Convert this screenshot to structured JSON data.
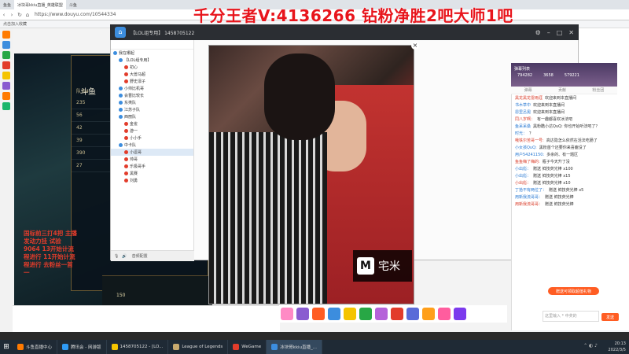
{
  "browser": {
    "tabs": [
      {
        "label": "鱼鱼",
        "active": false
      },
      {
        "label": "冰块哥kkiu直播_英雄联盟",
        "active": true
      },
      {
        "label": "斗鱼",
        "active": false
      }
    ],
    "url": "https://www.douyu.com/10544334",
    "bookmark": "点击加入收藏"
  },
  "banner": "千分王者V:4136266   钻粉净胜2吧大师1吧",
  "yy": {
    "title": "【LOL组专用】 1458705122",
    "tree": [
      {
        "label": "我在哪起",
        "indent": 0
      },
      {
        "label": "【LOL组专用】",
        "indent": 1
      },
      {
        "label": "初心",
        "indent": 2
      },
      {
        "label": "大兽马超",
        "indent": 2
      },
      {
        "label": "野史凛子",
        "indent": 2
      },
      {
        "label": "小帅比机哥",
        "indent": 1
      },
      {
        "label": "会晋比较长",
        "indent": 1
      },
      {
        "label": "东夷队",
        "indent": 1
      },
      {
        "label": "江苏子队",
        "indent": 1
      },
      {
        "label": "西丽队",
        "indent": 1
      },
      {
        "label": "金雀",
        "indent": 2
      },
      {
        "label": "游一",
        "indent": 2
      },
      {
        "label": "小小手",
        "indent": 2
      },
      {
        "label": "中卡队",
        "indent": 1
      },
      {
        "label": "小逗哥",
        "indent": 2,
        "selected": true
      },
      {
        "label": "帅哥",
        "indent": 2
      },
      {
        "label": "乐极哥手",
        "indent": 2
      },
      {
        "label": "黑赛",
        "indent": 2
      },
      {
        "label": "刘勇",
        "indent": 2
      }
    ],
    "bottom_label": "音频配置"
  },
  "game": {
    "title": "斗鱼",
    "rows": [
      {
        "num": "235",
        "text": ""
      },
      {
        "num": "56",
        "text": ""
      },
      {
        "num": "42",
        "text": ""
      },
      {
        "num": "39",
        "text": ""
      },
      {
        "num": "390",
        "text": ""
      },
      {
        "num": "27",
        "text": ""
      }
    ],
    "team_label": "队伍4",
    "red_message": "国标前三打4把 主播发动力挂 试验 9064 13开始计流程进行 11开始计流程进行 去粉丝一首一",
    "hud_stat": "150"
  },
  "video": {
    "brand": "宅米",
    "brand_mark": "M"
  },
  "chat": {
    "header": "弹幕列表",
    "stats": [
      "794282",
      "3658",
      "579221"
    ],
    "tabs": [
      "弹幕",
      "贡献",
      "粉丝团"
    ],
    "messages": [
      {
        "user": "黑龙黑龙雷雨涯",
        "text": "欢迎来到本直播间"
      },
      {
        "user": "书木草中",
        "text": "欢迎来到本直播间"
      },
      {
        "user": "恩里呂奧",
        "text": "欢迎来到本直播间"
      },
      {
        "user": "同八岁啊：",
        "text": "有一趣都喜欢冰法吧"
      },
      {
        "user": "鱼呆呆桑",
        "text": "黑粉酷小达QuQ: 你也开始听法吧了？"
      },
      {
        "user": "时光：",
        "text": "？"
      },
      {
        "user": "哦铁尔苦哥一号:",
        "text": "高达隐怎么依然在活法吃肠了"
      },
      {
        "user": "小女孩QuQ:",
        "text": "黑粉首个还要你来喜鹿没了"
      },
      {
        "user": "用户54241150:",
        "text": "多余的、有一题区"
      },
      {
        "user": "鱼鱼嗨了嗨的:",
        "text": "瓶子今天升了没"
      },
      {
        "user": "小出彪：",
        "text": "赠送 鲜技荧光棒 x100"
      },
      {
        "user": "小出彪：",
        "text": "赠送 鲜技荧光棒 x15"
      },
      {
        "user": "小出彪：",
        "text": "赠送 鲜技荧光棒 x10"
      },
      {
        "user": "丁拾不有两位了：",
        "text": "赠送 鲜技荧光棒 x5"
      },
      {
        "user": "用新我流哥哥：",
        "text": "赠送 鲜技荧光棒"
      },
      {
        "user": "用新我流哥哥：",
        "text": "赠送 鲜技荧光棒"
      }
    ],
    "gift_button": "赠送可领取超值礼物",
    "send_button": "发送",
    "input_placeholder": "这里输入 * 中奖的"
  },
  "taskbar": {
    "items": [
      {
        "label": "斗鱼直播中心",
        "color": "#ff7a00"
      },
      {
        "label": "腾讯会 - 网游版",
        "color": "#2e9af5"
      },
      {
        "label": "1458705122 - [LO...",
        "color": "#f5c400"
      },
      {
        "label": "League of Legends",
        "color": "#c8aa6e"
      },
      {
        "label": "WeGame",
        "color": "#e23c2b"
      },
      {
        "label": "冰块哥kkiu直播_...",
        "color": "#3c8dde",
        "active": true
      }
    ],
    "time": "20:13",
    "date": "2022/3/5"
  },
  "colors": {
    "banner_red": "#e8151c",
    "accent_orange": "#ff5d23",
    "link_blue": "#2a7ad3"
  }
}
